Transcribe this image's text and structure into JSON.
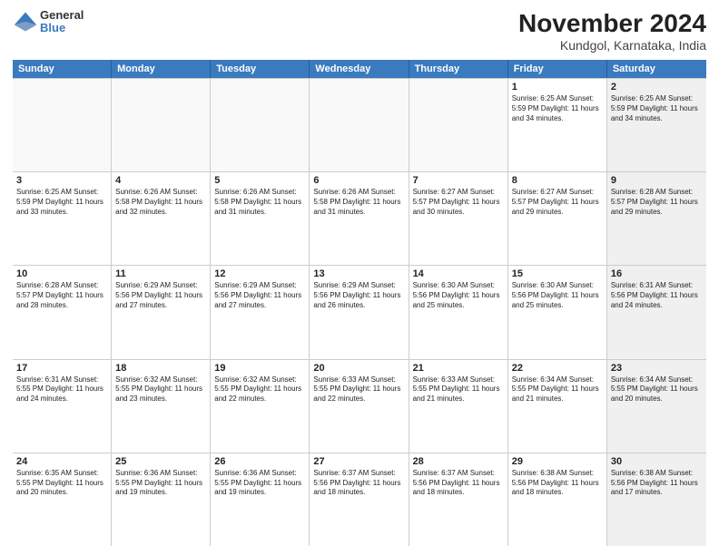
{
  "header": {
    "logo_general": "General",
    "logo_blue": "Blue",
    "title": "November 2024",
    "subtitle": "Kundgol, Karnataka, India"
  },
  "days_of_week": [
    "Sunday",
    "Monday",
    "Tuesday",
    "Wednesday",
    "Thursday",
    "Friday",
    "Saturday"
  ],
  "weeks": [
    [
      {
        "day": "",
        "info": "",
        "empty": true
      },
      {
        "day": "",
        "info": "",
        "empty": true
      },
      {
        "day": "",
        "info": "",
        "empty": true
      },
      {
        "day": "",
        "info": "",
        "empty": true
      },
      {
        "day": "",
        "info": "",
        "empty": true
      },
      {
        "day": "1",
        "info": "Sunrise: 6:25 AM\nSunset: 5:59 PM\nDaylight: 11 hours\nand 34 minutes."
      },
      {
        "day": "2",
        "info": "Sunrise: 6:25 AM\nSunset: 5:59 PM\nDaylight: 11 hours\nand 34 minutes.",
        "shaded": true
      }
    ],
    [
      {
        "day": "3",
        "info": "Sunrise: 6:25 AM\nSunset: 5:59 PM\nDaylight: 11 hours\nand 33 minutes."
      },
      {
        "day": "4",
        "info": "Sunrise: 6:26 AM\nSunset: 5:58 PM\nDaylight: 11 hours\nand 32 minutes."
      },
      {
        "day": "5",
        "info": "Sunrise: 6:26 AM\nSunset: 5:58 PM\nDaylight: 11 hours\nand 31 minutes."
      },
      {
        "day": "6",
        "info": "Sunrise: 6:26 AM\nSunset: 5:58 PM\nDaylight: 11 hours\nand 31 minutes."
      },
      {
        "day": "7",
        "info": "Sunrise: 6:27 AM\nSunset: 5:57 PM\nDaylight: 11 hours\nand 30 minutes."
      },
      {
        "day": "8",
        "info": "Sunrise: 6:27 AM\nSunset: 5:57 PM\nDaylight: 11 hours\nand 29 minutes."
      },
      {
        "day": "9",
        "info": "Sunrise: 6:28 AM\nSunset: 5:57 PM\nDaylight: 11 hours\nand 29 minutes.",
        "shaded": true
      }
    ],
    [
      {
        "day": "10",
        "info": "Sunrise: 6:28 AM\nSunset: 5:57 PM\nDaylight: 11 hours\nand 28 minutes."
      },
      {
        "day": "11",
        "info": "Sunrise: 6:29 AM\nSunset: 5:56 PM\nDaylight: 11 hours\nand 27 minutes."
      },
      {
        "day": "12",
        "info": "Sunrise: 6:29 AM\nSunset: 5:56 PM\nDaylight: 11 hours\nand 27 minutes."
      },
      {
        "day": "13",
        "info": "Sunrise: 6:29 AM\nSunset: 5:56 PM\nDaylight: 11 hours\nand 26 minutes."
      },
      {
        "day": "14",
        "info": "Sunrise: 6:30 AM\nSunset: 5:56 PM\nDaylight: 11 hours\nand 25 minutes."
      },
      {
        "day": "15",
        "info": "Sunrise: 6:30 AM\nSunset: 5:56 PM\nDaylight: 11 hours\nand 25 minutes."
      },
      {
        "day": "16",
        "info": "Sunrise: 6:31 AM\nSunset: 5:56 PM\nDaylight: 11 hours\nand 24 minutes.",
        "shaded": true
      }
    ],
    [
      {
        "day": "17",
        "info": "Sunrise: 6:31 AM\nSunset: 5:55 PM\nDaylight: 11 hours\nand 24 minutes."
      },
      {
        "day": "18",
        "info": "Sunrise: 6:32 AM\nSunset: 5:55 PM\nDaylight: 11 hours\nand 23 minutes."
      },
      {
        "day": "19",
        "info": "Sunrise: 6:32 AM\nSunset: 5:55 PM\nDaylight: 11 hours\nand 22 minutes."
      },
      {
        "day": "20",
        "info": "Sunrise: 6:33 AM\nSunset: 5:55 PM\nDaylight: 11 hours\nand 22 minutes."
      },
      {
        "day": "21",
        "info": "Sunrise: 6:33 AM\nSunset: 5:55 PM\nDaylight: 11 hours\nand 21 minutes."
      },
      {
        "day": "22",
        "info": "Sunrise: 6:34 AM\nSunset: 5:55 PM\nDaylight: 11 hours\nand 21 minutes."
      },
      {
        "day": "23",
        "info": "Sunrise: 6:34 AM\nSunset: 5:55 PM\nDaylight: 11 hours\nand 20 minutes.",
        "shaded": true
      }
    ],
    [
      {
        "day": "24",
        "info": "Sunrise: 6:35 AM\nSunset: 5:55 PM\nDaylight: 11 hours\nand 20 minutes."
      },
      {
        "day": "25",
        "info": "Sunrise: 6:36 AM\nSunset: 5:55 PM\nDaylight: 11 hours\nand 19 minutes."
      },
      {
        "day": "26",
        "info": "Sunrise: 6:36 AM\nSunset: 5:55 PM\nDaylight: 11 hours\nand 19 minutes."
      },
      {
        "day": "27",
        "info": "Sunrise: 6:37 AM\nSunset: 5:56 PM\nDaylight: 11 hours\nand 18 minutes."
      },
      {
        "day": "28",
        "info": "Sunrise: 6:37 AM\nSunset: 5:56 PM\nDaylight: 11 hours\nand 18 minutes."
      },
      {
        "day": "29",
        "info": "Sunrise: 6:38 AM\nSunset: 5:56 PM\nDaylight: 11 hours\nand 18 minutes."
      },
      {
        "day": "30",
        "info": "Sunrise: 6:38 AM\nSunset: 5:56 PM\nDaylight: 11 hours\nand 17 minutes.",
        "shaded": true
      }
    ]
  ]
}
